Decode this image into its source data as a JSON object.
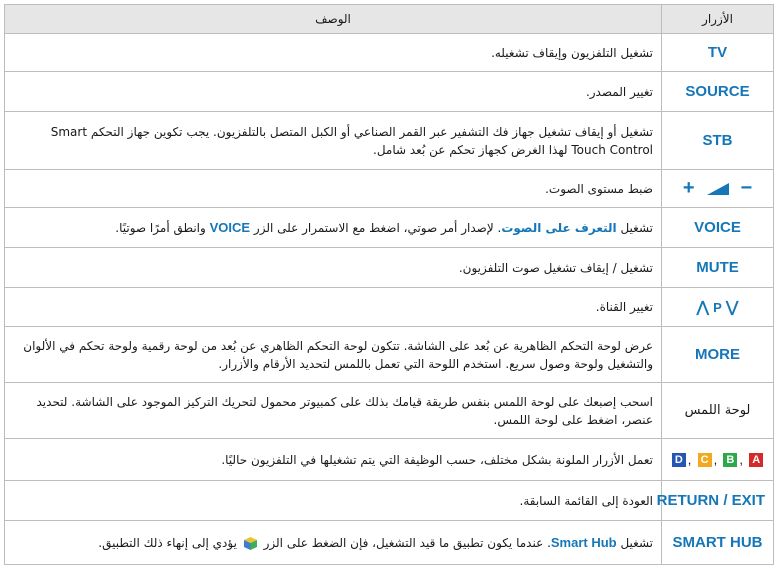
{
  "header": {
    "buttons_col": "الأزرار",
    "description_col": "الوصف"
  },
  "rows": {
    "tv": {
      "button": "TV",
      "desc": "تشغيل التلفزيون وإيقاف تشغيله."
    },
    "source": {
      "button": "SOURCE",
      "desc": "تغيير المصدر."
    },
    "stb": {
      "button": "STB",
      "desc_line1": "تشغيل أو إيقاف تشغيل جهاز فك التشفير عبر القمر الصناعي أو الكبل المتصل بالتلفزيون. يجب تكوين جهاز التحكم Smart",
      "desc_line2": "Touch Control لهذا الغرض كجهاز تحكم عن بُعد شامل."
    },
    "volume": {
      "button_minus": "−",
      "button_plus": "+",
      "desc": "ضبط مستوى الصوت."
    },
    "voice": {
      "button": "VOICE",
      "desc_part1": "تشغيل",
      "desc_highlight": "التعرف على الصوت",
      "desc_part2": ". لإصدار أمر صوتي، اضغط مع الاستمرار على الزر",
      "desc_keyword": "VOICE",
      "desc_part3": "وانطق أمرًا صوتيًا."
    },
    "mute": {
      "button": "MUTE",
      "desc": "تشغيل / إيقاف تشغيل صوت التلفزيون."
    },
    "channel": {
      "button_up": "⋀",
      "button_p": "P",
      "button_down": "⋁",
      "desc": "تغيير القناة."
    },
    "more": {
      "button": "MORE",
      "desc_line1": "عرض لوحة التحكم الظاهرية عن بُعد على الشاشة. تتكون لوحة التحكم الظاهري عن بُعد من لوحة رقمية ولوحة تحكم في الألوان",
      "desc_line2": "والتشغيل ولوحة وصول سريع. استخدم اللوحة التي تعمل باللمس لتحديد الأرقام والأزرار."
    },
    "touchpad": {
      "button": "لوحة اللمس",
      "desc_line1": "اسحب إصبعك على لوحة اللمس بنفس طريقة قيامك بذلك على كمبيوتر محمول لتحريك التركيز الموجود على الشاشة. لتحديد",
      "desc_line2": "عنصر، اضغط على لوحة اللمس."
    },
    "color_keys": {
      "keys": [
        {
          "label": "A",
          "color": "#d42a2a"
        },
        {
          "label": "B",
          "color": "#2ea84a"
        },
        {
          "label": "C",
          "color": "#f2a81f"
        },
        {
          "label": "D",
          "color": "#2456b3"
        }
      ],
      "desc": "تعمل الأزرار الملونة بشكل مختلف، حسب الوظيفة التي يتم تشغيلها في التلفزيون حاليًا."
    },
    "return_exit": {
      "button_return": "RETURN",
      "separator": "/",
      "button_exit": "EXIT",
      "desc": "العودة إلى القائمة السابقة."
    },
    "smart_hub": {
      "button": "SMART HUB",
      "desc_part1": "تشغيل",
      "desc_keyword": "Smart Hub",
      "desc_part2": ". عندما يكون تطبيق ما قيد التشغيل، فإن الضغط على الزر",
      "desc_part3": "يؤدي إلى إنهاء ذلك التطبيق."
    }
  },
  "colors": {
    "accent": "#1577b8",
    "header_bg": "#e6e6e6",
    "border": "#bdbdbd"
  }
}
